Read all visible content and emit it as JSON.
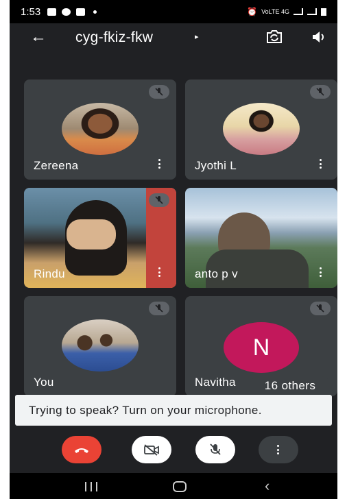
{
  "status_bar": {
    "time": "1:53",
    "network": "VoLTE 4G"
  },
  "top_bar": {
    "meeting_code": "cyg-fkiz-fkw",
    "caret": "▸"
  },
  "participants": [
    {
      "name": "Zereena",
      "muted": true
    },
    {
      "name": "Jyothi L",
      "muted": true
    },
    {
      "name": "Rindu",
      "muted": true
    },
    {
      "name": "anto p v",
      "muted": false
    },
    {
      "name": "You",
      "muted": true
    },
    {
      "name": "Navitha",
      "muted": true,
      "initial": "N",
      "avatar_color": "#c2185b"
    }
  ],
  "others_label": "16 others",
  "mic_banner": "Trying to speak? Turn on your microphone.",
  "colors": {
    "end_call": "#ea4335",
    "tile": "#3c4043",
    "background": "#202124"
  }
}
